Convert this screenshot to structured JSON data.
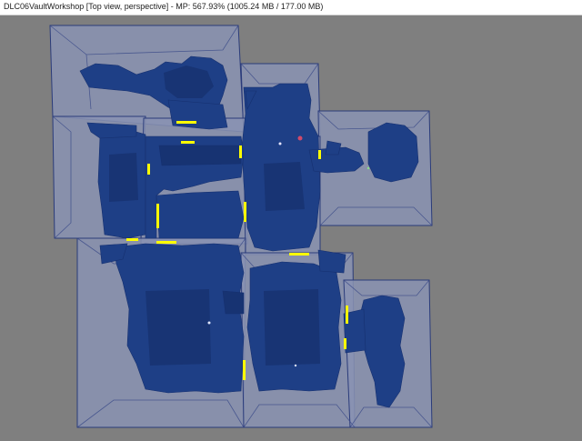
{
  "window": {
    "title": "DLC06VaultWorkshop [Top view, perspective] - MP: 567.93% (1005.24 MB / 177.00 MB)"
  },
  "viewport": {
    "view_mode": "Top view, perspective",
    "colors": {
      "background": "#7f7f7f",
      "cell_box_fill": "#8a93b3",
      "cell_box_stroke": "#2a3b7a",
      "geometry": "#1e3f86",
      "geometry_dark": "#173372",
      "marker": "#ffff00"
    }
  }
}
